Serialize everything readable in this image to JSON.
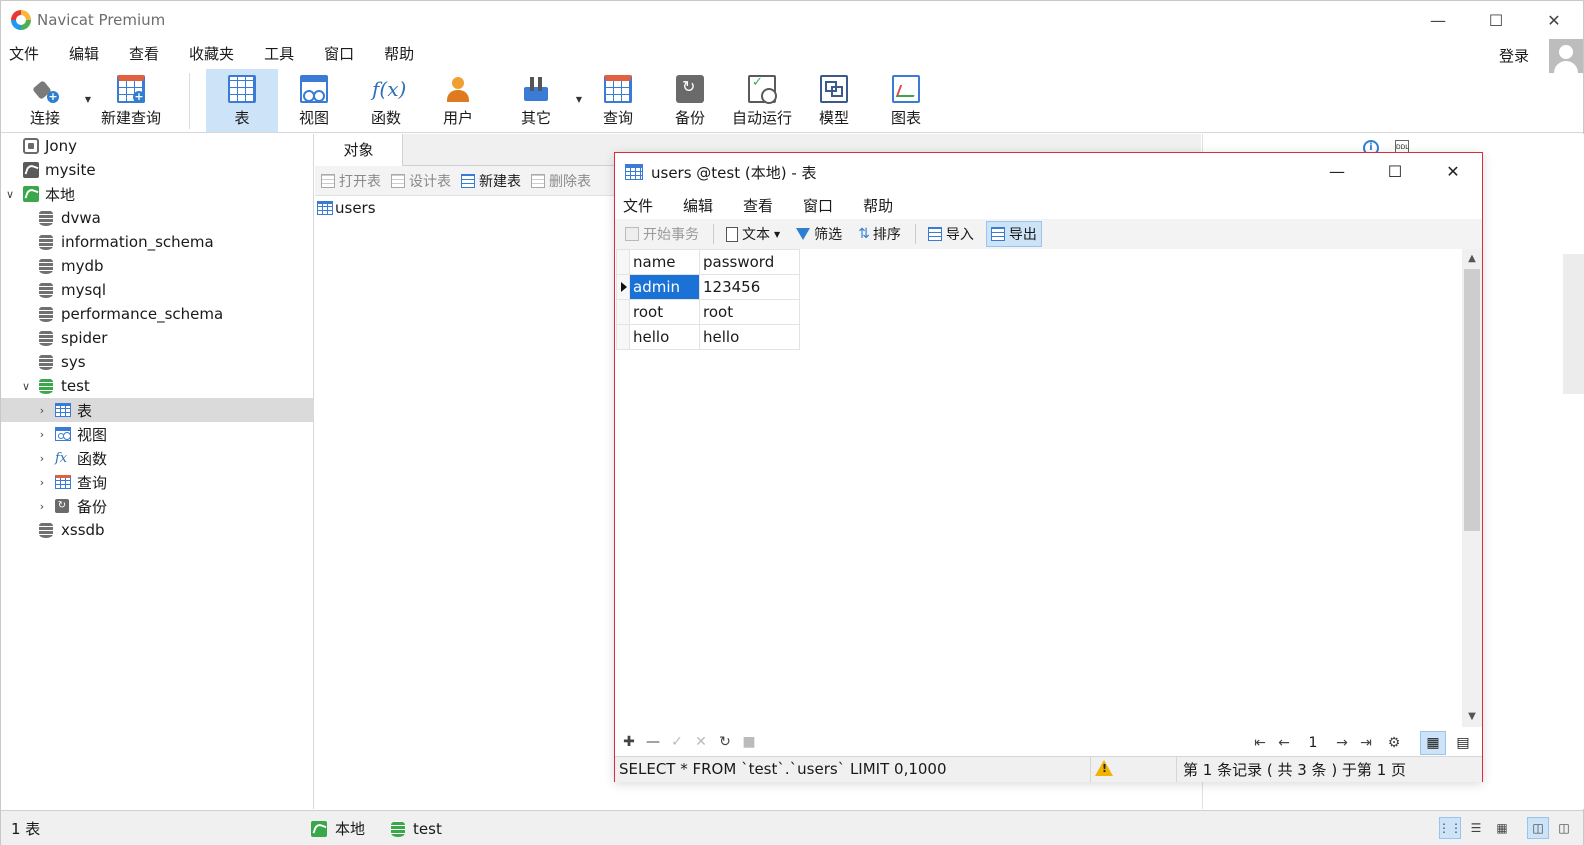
{
  "app": {
    "title": "Navicat Premium",
    "login": "登录"
  },
  "menu": [
    "文件",
    "编辑",
    "查看",
    "收藏夹",
    "工具",
    "窗口",
    "帮助"
  ],
  "toolbar": [
    {
      "label": "连接",
      "icon": "plug-icon"
    },
    {
      "label": "新建查询",
      "icon": "new-query-icon"
    },
    {
      "label": "表",
      "icon": "table-icon"
    },
    {
      "label": "视图",
      "icon": "view-icon"
    },
    {
      "label": "函数",
      "icon": "function-icon"
    },
    {
      "label": "用户",
      "icon": "user-icon"
    },
    {
      "label": "其它",
      "icon": "tools-icon"
    },
    {
      "label": "查询",
      "icon": "query-icon"
    },
    {
      "label": "备份",
      "icon": "backup-icon"
    },
    {
      "label": "自动运行",
      "icon": "auto-run-icon"
    },
    {
      "label": "模型",
      "icon": "model-icon"
    },
    {
      "label": "图表",
      "icon": "chart-icon"
    }
  ],
  "tree": {
    "connections": [
      "Jony",
      "mysite",
      "本地"
    ],
    "databases": [
      "dvwa",
      "information_schema",
      "mydb",
      "mysql",
      "performance_schema",
      "spider",
      "sys",
      "test",
      "xssdb"
    ],
    "test_children": [
      "表",
      "视图",
      "函数",
      "查询",
      "备份"
    ]
  },
  "objects": {
    "tab": "对象",
    "actions": [
      "打开表",
      "设计表",
      "新建表",
      "删除表"
    ],
    "items": [
      "users"
    ]
  },
  "statusbar": {
    "count": "1 表",
    "connection": "本地",
    "database": "test"
  },
  "table_window": {
    "title": "users @test (本地) - 表",
    "menu": [
      "文件",
      "编辑",
      "查看",
      "窗口",
      "帮助"
    ],
    "toolbar": {
      "begin_tx": "开始事务",
      "text": "文本",
      "filter": "筛选",
      "sort": "排序",
      "import": "导入",
      "export": "导出"
    },
    "columns": [
      "name",
      "password"
    ],
    "rows": [
      [
        "admin",
        "123456"
      ],
      [
        "root",
        "root"
      ],
      [
        "hello",
        "hello"
      ]
    ],
    "page": "1",
    "sql": "SELECT * FROM `test`.`users` LIMIT 0,1000",
    "record_info": "第 1 条记录 ( 共 3 条 ) 于第 1 页"
  }
}
